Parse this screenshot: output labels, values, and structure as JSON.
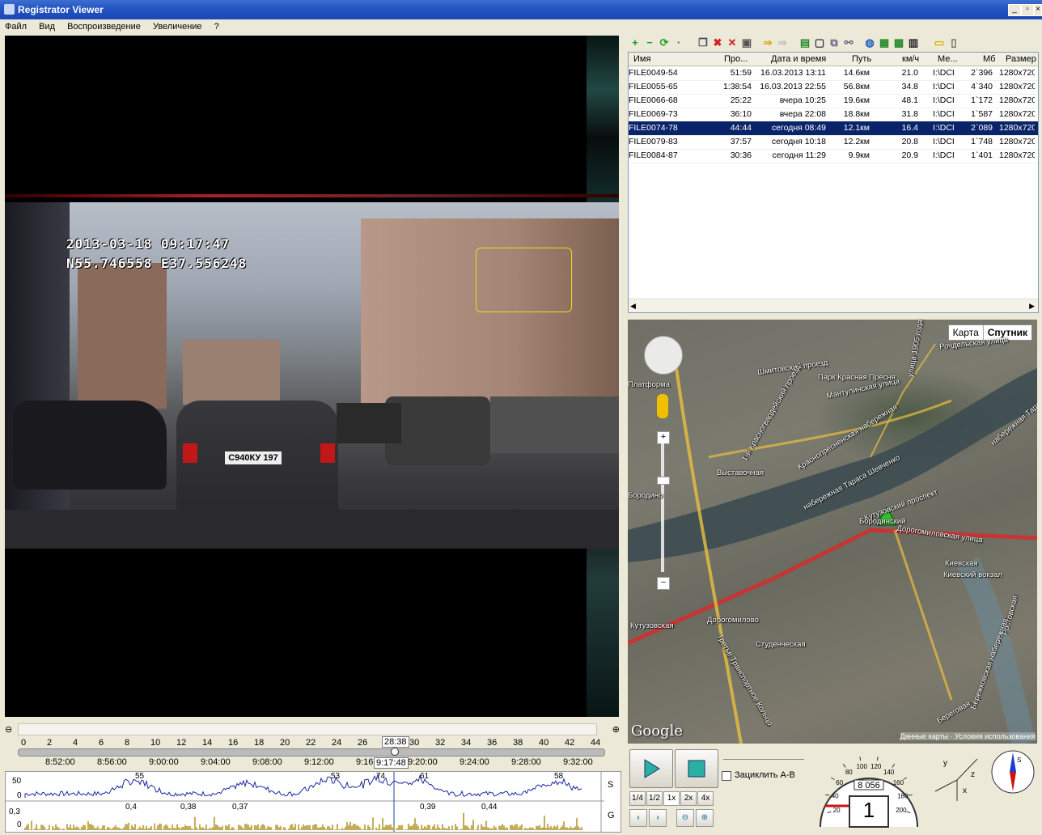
{
  "window": {
    "title": "Registrator Viewer",
    "btn_min": "_",
    "btn_max": "▫",
    "btn_close": "×"
  },
  "menu": [
    "Файл",
    "Вид",
    "Воспроизведение",
    "Увеличение",
    "?"
  ],
  "video": {
    "osd_datetime": "2013-03-18  09:17:47",
    "osd_coords": "N55.746558  E37.556248",
    "plate": "С940КУ 197"
  },
  "file_list": {
    "columns": [
      "Имя",
      "Про...",
      "Дата и время",
      "Путь",
      "км/ч",
      "Ме...",
      "Мб",
      "Размер"
    ],
    "rows": [
      [
        "FILE0049-54",
        "51:59",
        "16.03.2013 13:11",
        "14.6км",
        "21.0",
        "I:\\DCI..",
        "2`396",
        "1280x720"
      ],
      [
        "FILE0055-65",
        "1:38:54",
        "16.03.2013 22:55",
        "56.8км",
        "34.8",
        "I:\\DCI..",
        "4`340",
        "1280x720"
      ],
      [
        "FILE0066-68",
        "25:22",
        "вчера 10:25",
        "19.6км",
        "48.1",
        "I:\\DCI..",
        "1`172",
        "1280x720"
      ],
      [
        "FILE0069-73",
        "36:10",
        "вчера 22:08",
        "18.8км",
        "31.8",
        "I:\\DCI..",
        "1`587",
        "1280x720"
      ],
      [
        "FILE0074-78",
        "44:44",
        "сегодня 08:49",
        "12.1км",
        "16.4",
        "I:\\DCI..",
        "2`089",
        "1280x720"
      ],
      [
        "FILE0079-83",
        "37:57",
        "сегодня 10:18",
        "12.2км",
        "20.8",
        "I:\\DCI..",
        "1`748",
        "1280x720"
      ],
      [
        "FILE0084-87",
        "30:36",
        "сегодня 11:29",
        "9.9км",
        "20.9",
        "I:\\DCI..",
        "1`401",
        "1280x720"
      ]
    ],
    "selected_index": 4
  },
  "map": {
    "type_map": "Карта",
    "type_sat": "Спутник",
    "labels": [
      "Шмитовский проезд",
      "Мантулинская улица",
      "улица 1905 года",
      "Рочдельская улица",
      "Парк Красная Пресня",
      "1-й Красногвардейский проезд",
      "Краснопресненская набережная",
      "набережная Тараса Шевченко",
      "Кутузовский проспект",
      "Дорогомиловская улица",
      "Выставочная",
      "Бородинский",
      "Киевская",
      "Киевский вокзал",
      "Кутузовская",
      "Дорогомилово",
      "Студенческая",
      "Третье Транспортное Кольцо",
      "Бережковская набережная",
      "Ростовская",
      "Бородино",
      "набережная Тараса",
      "Платформа",
      "Береговая"
    ],
    "google": "Google",
    "attribution": "Данные карты · Условия использования"
  },
  "timeline": {
    "minute_ticks": [
      "0",
      "2",
      "4",
      "6",
      "8",
      "10",
      "12",
      "14",
      "16",
      "18",
      "20",
      "22",
      "24",
      "26",
      "28",
      "30",
      "32",
      "34",
      "36",
      "38",
      "40",
      "42",
      "44"
    ],
    "current_minute": "28:38",
    "clock_ticks": [
      "8:52:00",
      "8:56:00",
      "9:00:00",
      "9:04:00",
      "9:08:00",
      "9:12:00",
      "9:16",
      "9:20:00",
      "9:24:00",
      "9:28:00",
      "9:32:00"
    ],
    "current_clock": "9:17:48"
  },
  "graphs": {
    "speed": {
      "label": "S",
      "y_ticks": [
        "50",
        "0"
      ],
      "peaks": [
        "55",
        "53",
        "74",
        "61",
        "58"
      ]
    },
    "g": {
      "label": "G",
      "y_ticks": [
        "0,3",
        "0"
      ],
      "peaks": [
        "0,4",
        "0,38",
        "0,37",
        "0,39",
        "0,44"
      ]
    }
  },
  "controls": {
    "loop_label": "Зациклить A-B",
    "speeds": [
      "1/4",
      "1/2",
      "1x",
      "2x",
      "4x"
    ],
    "speedometer": {
      "odometer": "8 056",
      "gear": "1",
      "ticks": [
        "20",
        "40",
        "60",
        "80",
        "100",
        "120",
        "140",
        "160",
        "180",
        "200"
      ]
    },
    "axes": {
      "x": "x",
      "y": "y",
      "z": "z"
    },
    "compass": "S"
  }
}
